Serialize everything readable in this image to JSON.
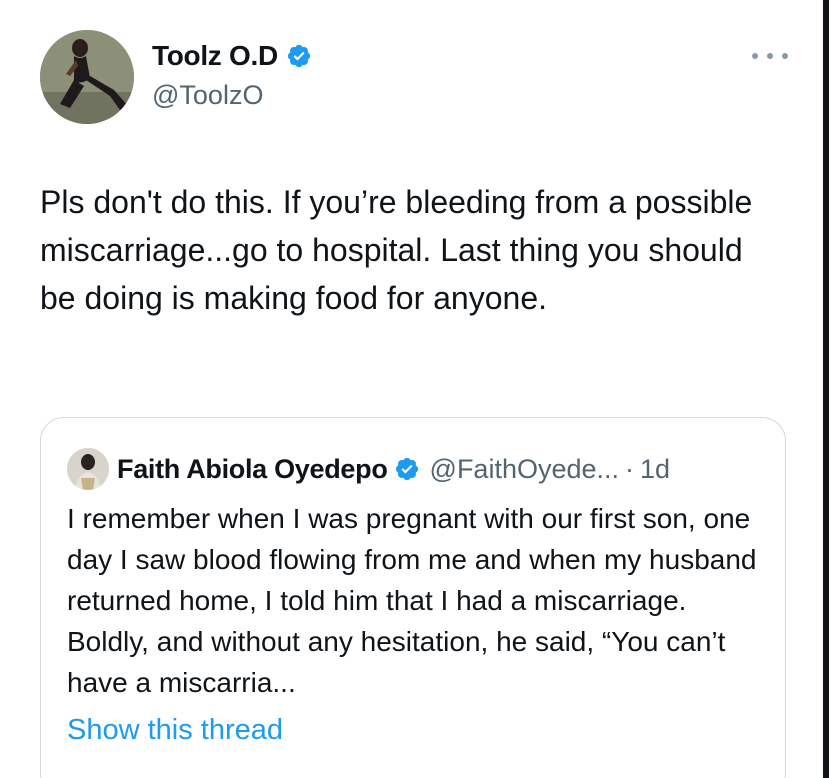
{
  "author": {
    "name": "Toolz O.D",
    "handle": "@ToolzO",
    "verified": true
  },
  "tweet": {
    "text": "Pls don't do this. If you’re bleeding from a possible miscarriage...go to hospital. Last thing you should be doing is making food for anyone."
  },
  "quoted_tweet": {
    "name": "Faith Abiola Oyedepo",
    "handle": "@FaithOyede...",
    "separator": "·",
    "time": "1d",
    "verified": true,
    "text": "I remember when I was pregnant with our first son, one day I saw blood flowing from me and when my husband returned home, I told him that I had a miscarriage. Boldly, and without any hesitation, he said, “You can’t have a miscarria...",
    "show_thread_label": "Show this thread"
  },
  "colors": {
    "verified_badge": "#1d9bf0",
    "link": "#1d9bf0",
    "secondary_text": "#536471",
    "border": "#cfd9de"
  },
  "icons": {
    "more": "more-horizontal-icon",
    "verified": "verified-badge-icon"
  }
}
